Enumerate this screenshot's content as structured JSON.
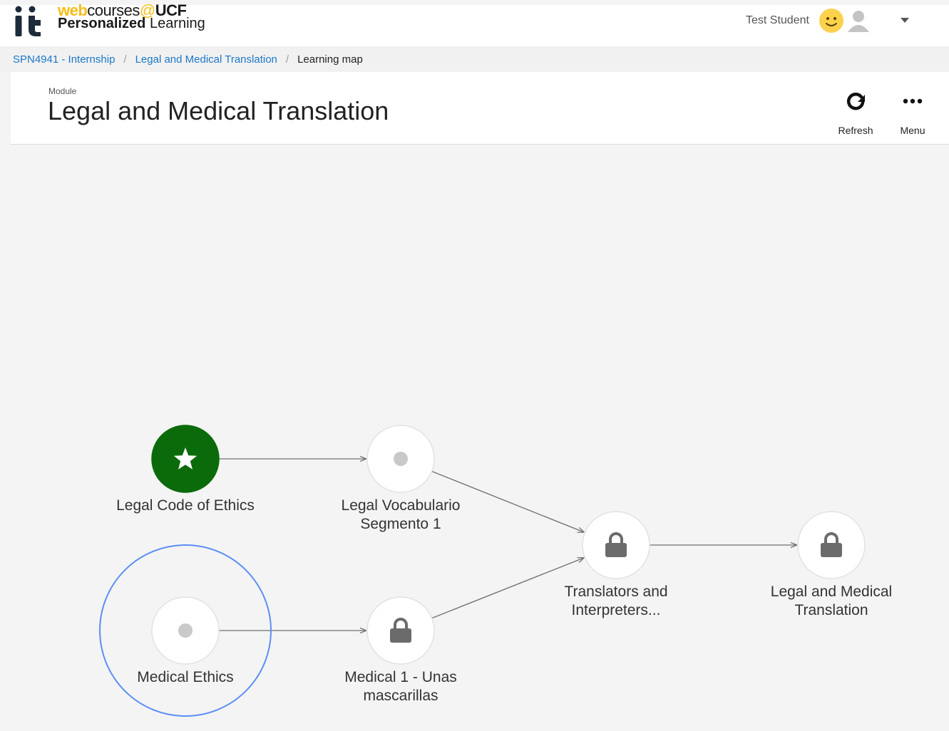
{
  "app": {
    "logo_brand_web": "web",
    "logo_brand_courses": "courses",
    "logo_brand_at": "@",
    "logo_brand_ucf": "UCF",
    "logo_sub_bold": "Personalized",
    "logo_sub_regular": " Learning"
  },
  "user": {
    "name": "Test Student"
  },
  "breadcrumb": {
    "items": [
      {
        "label": "SPN4941 - Internship"
      },
      {
        "label": "Legal and Medical Translation"
      },
      {
        "label": "Learning map"
      }
    ],
    "separator": "/"
  },
  "header": {
    "kind_label": "Module",
    "title": "Legal and Medical Translation",
    "refresh_label": "Refresh",
    "menu_label": "Menu"
  },
  "colors": {
    "link": "#1b78c8",
    "completed_node": "#0b6b0b",
    "focus_ring": "#5b8ff5",
    "lock": "#6b6b6b",
    "edge": "#6f6f6f"
  },
  "learning_map": {
    "nodes": [
      {
        "id": "legal-code-of-ethics",
        "label_lines": [
          "Legal Code of Ethics"
        ],
        "status": "completed",
        "icon": "star-icon"
      },
      {
        "id": "legal-vocabulario",
        "label_lines": [
          "Legal Vocabulario",
          "Segmento 1"
        ],
        "status": "available",
        "icon": "dot-icon"
      },
      {
        "id": "medical-ethics",
        "label_lines": [
          "Medical Ethics"
        ],
        "status": "available",
        "icon": "dot-icon",
        "focused": true
      },
      {
        "id": "medical-1",
        "label_lines": [
          "Medical 1 - Unas",
          "mascarillas"
        ],
        "status": "locked",
        "icon": "lock-icon"
      },
      {
        "id": "translators-interpreters",
        "label_lines": [
          "Translators and",
          "Interpreters..."
        ],
        "status": "locked",
        "icon": "lock-icon"
      },
      {
        "id": "legal-medical-translation",
        "label_lines": [
          "Legal and Medical",
          "Translation"
        ],
        "status": "locked",
        "icon": "lock-icon"
      }
    ],
    "edges": [
      {
        "from": "legal-code-of-ethics",
        "to": "legal-vocabulario"
      },
      {
        "from": "medical-ethics",
        "to": "medical-1"
      },
      {
        "from": "legal-vocabulario",
        "to": "translators-interpreters"
      },
      {
        "from": "medical-1",
        "to": "translators-interpreters"
      },
      {
        "from": "translators-interpreters",
        "to": "legal-medical-translation"
      }
    ]
  }
}
